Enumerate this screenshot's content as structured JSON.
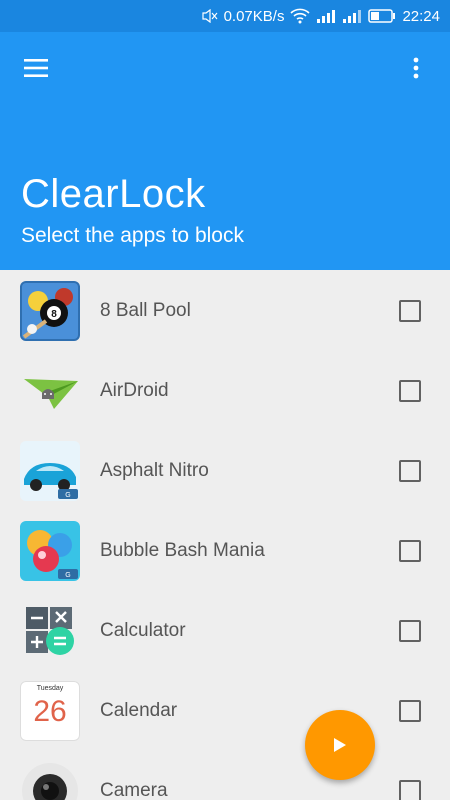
{
  "status_bar": {
    "speed": "0.07KB/s",
    "time": "22:24",
    "icons": [
      "mute-icon",
      "wifi-icon",
      "signal-icon",
      "3g-signal-icon",
      "battery-icon"
    ]
  },
  "app_bar": {
    "title": "ClearLock",
    "subtitle": "Select the apps to block",
    "color": "#2196f3",
    "status_color": "#1a86e0"
  },
  "apps": [
    {
      "name": "8 Ball Pool",
      "icon": "8-ball-pool-icon",
      "checked": false
    },
    {
      "name": "AirDroid",
      "icon": "airdroid-icon",
      "checked": false
    },
    {
      "name": "Asphalt Nitro",
      "icon": "asphalt-nitro-icon",
      "checked": false
    },
    {
      "name": "Bubble Bash Mania",
      "icon": "bubble-bash-mania-icon",
      "checked": false
    },
    {
      "name": "Calculator",
      "icon": "calculator-icon",
      "checked": false
    },
    {
      "name": "Calendar",
      "icon": "calendar-icon",
      "checked": false,
      "icon_text": {
        "weekday": "Tuesday",
        "day": "26"
      }
    },
    {
      "name": "Camera",
      "icon": "camera-icon",
      "checked": false
    }
  ],
  "fab": {
    "icon": "play-icon",
    "color": "#ff9800"
  }
}
